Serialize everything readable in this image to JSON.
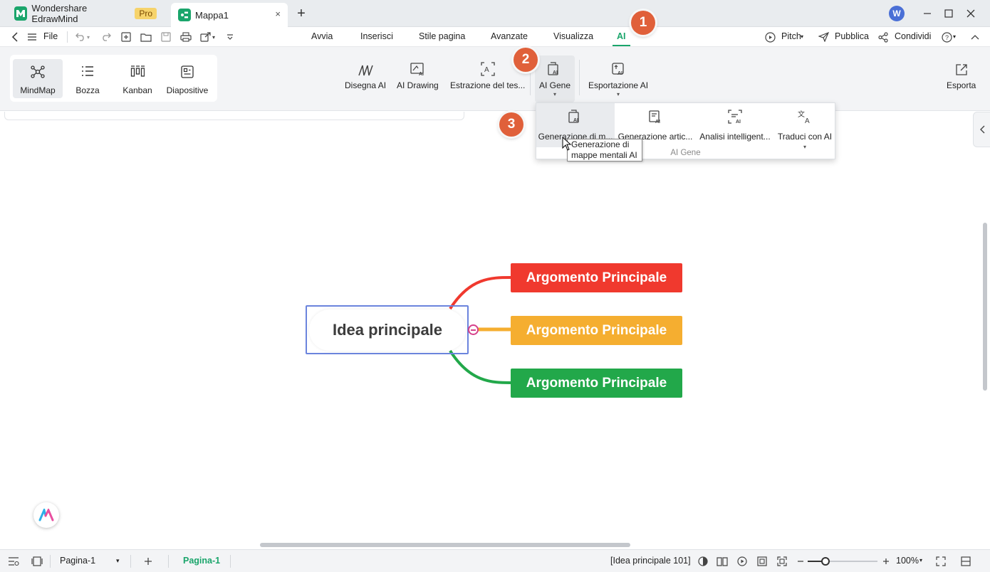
{
  "titlebar": {
    "app_name": "Wondershare EdrawMind",
    "pro_label": "Pro",
    "doc_tab": "Mappa1",
    "close_tab": "×",
    "new_tab": "+",
    "avatar": "W"
  },
  "menubar": {
    "file": "File",
    "tabs": [
      "Avvia",
      "Inserisci",
      "Stile pagina",
      "Avanzate",
      "Visualizza",
      "AI"
    ],
    "active_tab": "AI",
    "pitch": "Pitch",
    "publish": "Pubblica",
    "share": "Condividi"
  },
  "ribbon": {
    "views": [
      "MindMap",
      "Bozza",
      "Kanban",
      "Diapositive"
    ],
    "selected_view": "MindMap",
    "ai_buttons": {
      "draw_ai": "Disegna AI",
      "ai_drawing": "AI Drawing",
      "text_extract": "Estrazione del tes...",
      "ai_gene": "AI Gene",
      "ai_export": "Esportazione AI",
      "export": "Esporta"
    }
  },
  "dropdown": {
    "items": [
      "Generazione di m...",
      "Generazione artic...",
      "Analisi intelligent...",
      "Traduci con AI"
    ],
    "group_label": "AI Gene",
    "tooltip_line1": "Generazione di",
    "tooltip_line2": "mappe mentali AI"
  },
  "steps": [
    "1",
    "2",
    "3"
  ],
  "mindmap": {
    "central": "Idea principale",
    "topics": [
      {
        "label": "Argomento Principale",
        "color": "#f0392e"
      },
      {
        "label": "Argomento Principale",
        "color": "#f5ae30"
      },
      {
        "label": "Argomento Principale",
        "color": "#22a84a"
      }
    ]
  },
  "statusbar": {
    "page_select": "Pagina-1",
    "active_page": "Pagina-1",
    "selection_info": "[Idea principale 101]",
    "zoom": "100%"
  },
  "colors": {
    "accent_green": "#1aa56b",
    "badge": "#e0603a",
    "central_border": "#6b84dd"
  }
}
